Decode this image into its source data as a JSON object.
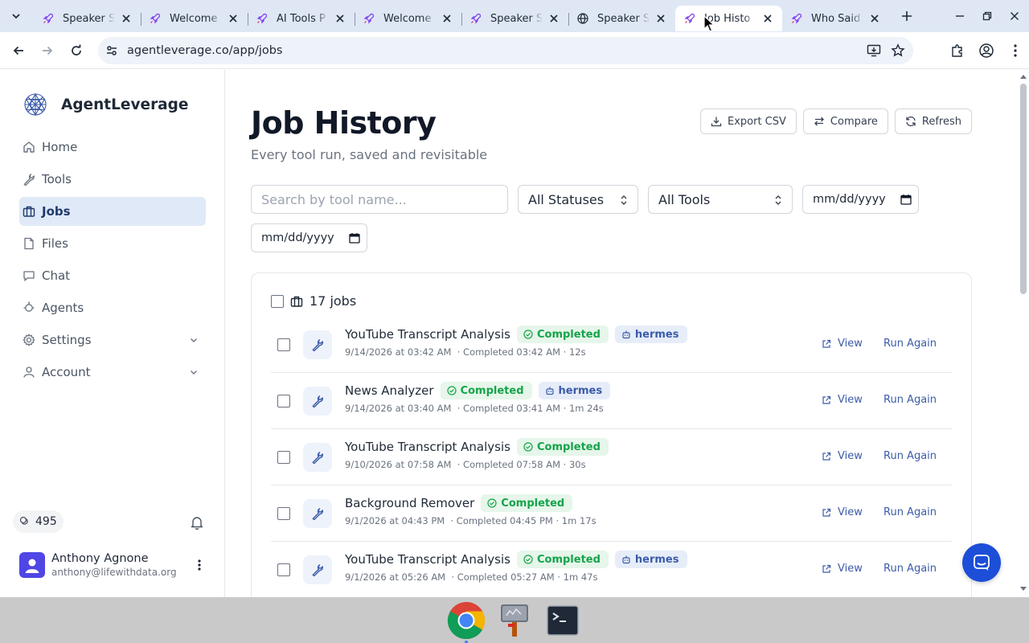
{
  "browser": {
    "tabs": [
      {
        "title": "Speaker S",
        "favicon": "rocket-icon",
        "active": false
      },
      {
        "title": "Welcome",
        "favicon": "rocket-icon",
        "active": false
      },
      {
        "title": "AI Tools P",
        "favicon": "rocket-icon",
        "active": false
      },
      {
        "title": "Welcome",
        "favicon": "rocket-icon",
        "active": false
      },
      {
        "title": "Speaker S",
        "favicon": "rocket-icon",
        "active": false
      },
      {
        "title": "Speaker S",
        "favicon": "globe-icon",
        "active": false
      },
      {
        "title": "Job Histo",
        "favicon": "rocket-icon",
        "active": true
      },
      {
        "title": "Who Said",
        "favicon": "rocket-icon",
        "active": false
      }
    ],
    "url": "agentleverage.co/app/jobs"
  },
  "sidebar": {
    "brand": "AgentLeverage",
    "nav": [
      {
        "label": "Home",
        "icon": "home-icon",
        "active": false,
        "expandable": false
      },
      {
        "label": "Tools",
        "icon": "wrench-icon",
        "active": false,
        "expandable": false
      },
      {
        "label": "Jobs",
        "icon": "briefcase-icon",
        "active": true,
        "expandable": false
      },
      {
        "label": "Files",
        "icon": "file-icon",
        "active": false,
        "expandable": false
      },
      {
        "label": "Chat",
        "icon": "chat-icon",
        "active": false,
        "expandable": false
      },
      {
        "label": "Agents",
        "icon": "bot-icon",
        "active": false,
        "expandable": false
      },
      {
        "label": "Settings",
        "icon": "gear-icon",
        "active": false,
        "expandable": true
      },
      {
        "label": "Account",
        "icon": "user-icon",
        "active": false,
        "expandable": true
      }
    ],
    "credits": "495",
    "user": {
      "name": "Anthony Agnone",
      "email": "anthony@lifewithdata.org"
    }
  },
  "page": {
    "title": "Job History",
    "subtitle": "Every tool run, saved and revisitable",
    "actions": {
      "export": "Export CSV",
      "compare": "Compare",
      "refresh": "Refresh"
    },
    "filters": {
      "search_placeholder": "Search by tool name...",
      "status": "All Statuses",
      "tool": "All Tools",
      "date_from": "mm/dd/yyyy",
      "date_to": "mm/dd/yyyy"
    },
    "job_count": "17 jobs",
    "view_label": "View",
    "run_again_label": "Run Again",
    "jobs": [
      {
        "name": "YouTube Transcript Analysis",
        "status": "Completed",
        "agent": "hermes",
        "meta": "9/14/2026 at 03:42 AM  · Completed 03:42 AM · 12s"
      },
      {
        "name": "News Analyzer",
        "status": "Completed",
        "agent": "hermes",
        "meta": "9/14/2026 at 03:40 AM  · Completed 03:41 AM · 1m 24s"
      },
      {
        "name": "YouTube Transcript Analysis",
        "status": "Completed",
        "agent": "",
        "meta": "9/10/2026 at 07:58 AM  · Completed 07:58 AM · 30s"
      },
      {
        "name": "Background Remover",
        "status": "Completed",
        "agent": "",
        "meta": "9/1/2026 at 04:43 PM  · Completed 04:45 PM · 1m 17s"
      },
      {
        "name": "YouTube Transcript Analysis",
        "status": "Completed",
        "agent": "hermes",
        "meta": "9/1/2026 at 05:26 AM  · Completed 05:27 AM · 1m 47s"
      }
    ]
  },
  "colors": {
    "accent": "#3b5ba9",
    "success": "#16a34a",
    "active_nav_bg": "#e0e9f7",
    "fab": "#1d4ed8"
  }
}
